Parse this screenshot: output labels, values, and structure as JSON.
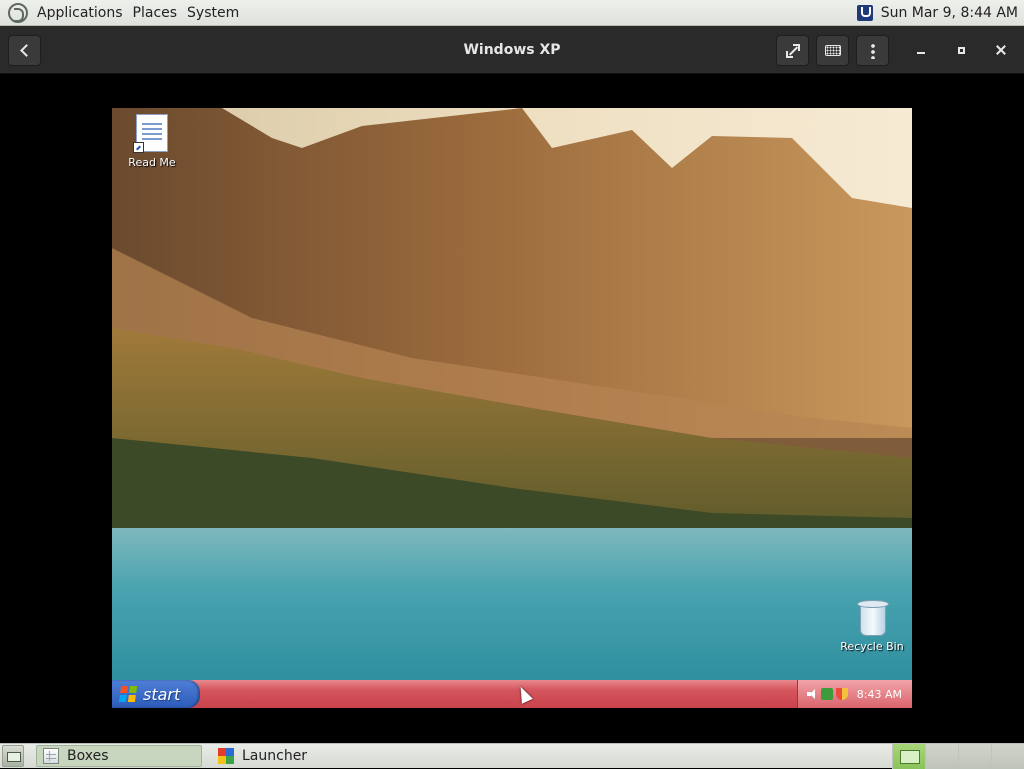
{
  "top_panel": {
    "menus": [
      "Applications",
      "Places",
      "System"
    ],
    "clock": "Sun Mar  9,  8:44 AM"
  },
  "header": {
    "title": "Windows XP"
  },
  "vm": {
    "desktop_icons": [
      {
        "label": "Read Me",
        "icon": "document-icon"
      },
      {
        "label": "Recycle Bin",
        "icon": "recycle-bin-icon"
      }
    ],
    "taskbar": {
      "start_label": "start",
      "clock": "8:43 AM"
    }
  },
  "bottom_panel": {
    "tasks": [
      {
        "label": "Boxes",
        "active": true
      },
      {
        "label": "Launcher",
        "active": false
      }
    ]
  }
}
